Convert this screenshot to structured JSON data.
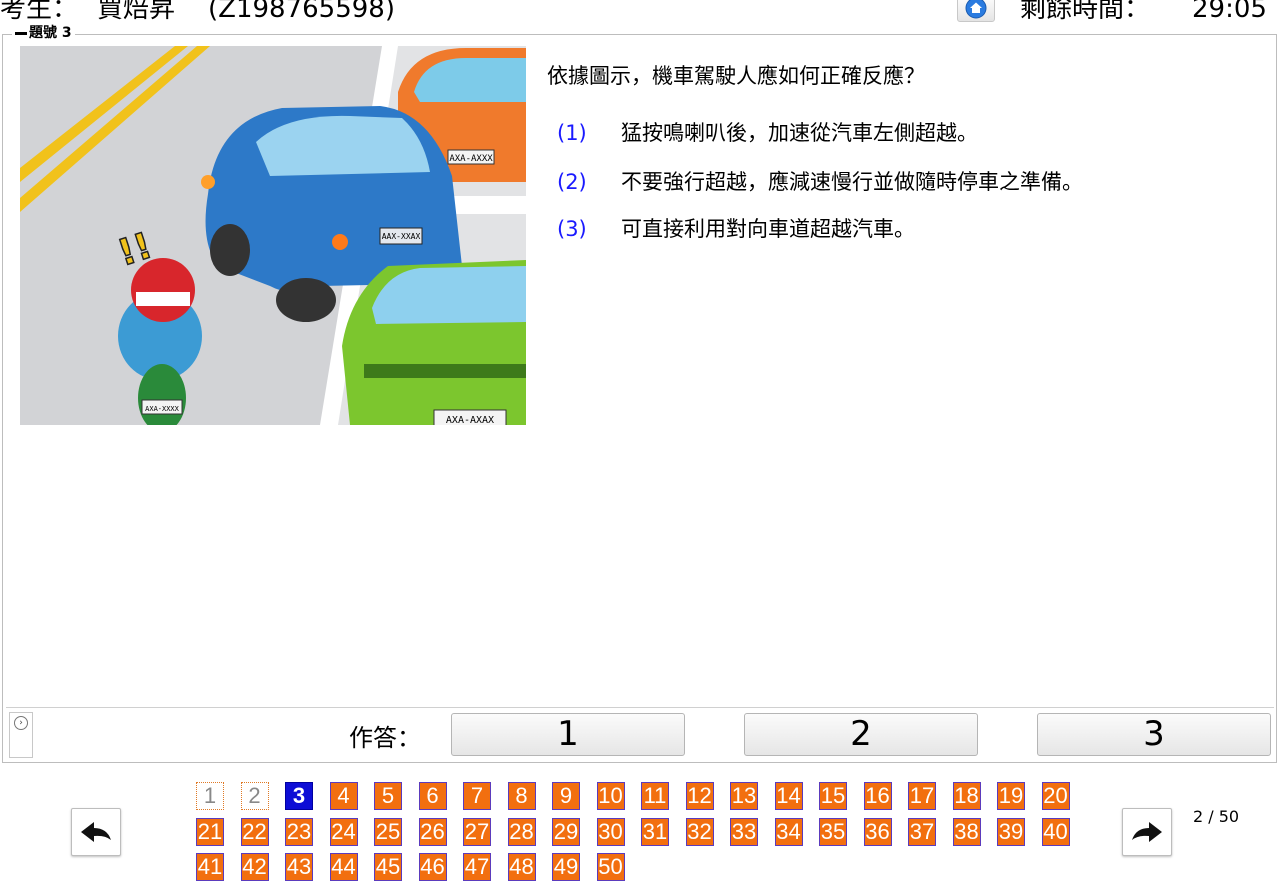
{
  "header": {
    "examinee_label": "考生：",
    "examinee_name": "賈焙昇",
    "examinee_id": "(Z198765598)",
    "home_icon": "home-icon",
    "time_label": "剩餘時間：",
    "time_value": "29:05"
  },
  "question": {
    "legend": "題號 3",
    "text": "依據圖示，機車駕駛人應如何正確反應？",
    "options": [
      {
        "num": "(1)",
        "text": "猛按鳴喇叭後，加速從汽車左側超越。"
      },
      {
        "num": "(2)",
        "text": "不要強行超越，應減速慢行並做隨時停車之準備。"
      },
      {
        "num": "(3)",
        "text": "可直接利用對向車道超越汽車。"
      }
    ],
    "image": {
      "plate_front": "AXA-AXXX",
      "plate_blue": "AAX-XXAX",
      "plate_green": "AXA-AXAX",
      "plate_scooter": "AXA-XXXX",
      "warning": "!!"
    }
  },
  "answer": {
    "label": "作答：",
    "choices": [
      "1",
      "2",
      "3"
    ],
    "collapse_icon": "chevron-right-circle-icon"
  },
  "navigator": {
    "prev_icon": "back-arrow-icon",
    "next_icon": "forward-arrow-icon",
    "current": 3,
    "answered": [
      1,
      2
    ],
    "total": 50,
    "numbers": [
      "1",
      "2",
      "3",
      "4",
      "5",
      "6",
      "7",
      "8",
      "9",
      "10",
      "11",
      "12",
      "13",
      "14",
      "15",
      "16",
      "17",
      "18",
      "19",
      "20",
      "21",
      "22",
      "23",
      "24",
      "25",
      "26",
      "27",
      "28",
      "29",
      "30",
      "31",
      "32",
      "33",
      "34",
      "35",
      "36",
      "37",
      "38",
      "39",
      "40",
      "41",
      "42",
      "43",
      "44",
      "45",
      "46",
      "47",
      "48",
      "49",
      "50"
    ],
    "page_count": "2 / 50"
  },
  "colors": {
    "option_number": "#1a1aff",
    "cell_unanswered": "#f26f0f",
    "cell_current": "#0d0dd6",
    "cell_border": "#5b3bbd"
  }
}
